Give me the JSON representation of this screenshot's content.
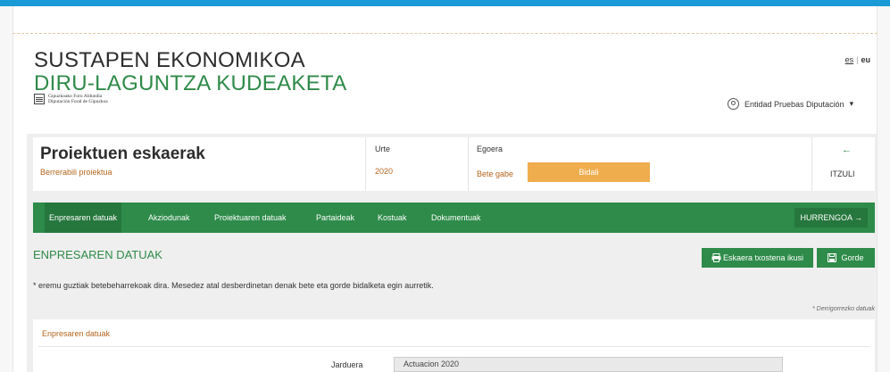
{
  "header": {
    "title_line1": "SUSTAPEN EKONOMIKOA",
    "title_line2": "DIRU-LAGUNTZA KUDEAKETA",
    "logo_line1": "Gipuzkoako Foru Aldundia",
    "logo_line2": "Diputación Foral de Gipuzkoa",
    "lang_es": "es",
    "lang_sep": "|",
    "lang_eu": "eu",
    "user_name": "Entidad Pruebas Diputación",
    "user_caret": "▾"
  },
  "project": {
    "title": "Proiektuen eskaerak",
    "subtitle": "Berrerabili proiektua",
    "year_label": "Urte",
    "year_value": "2020",
    "status_label": "Egoera",
    "status_value": "Bete gabe",
    "send_label": "Bidali",
    "back_arrow": "←",
    "back_label": "ITZULI"
  },
  "tabs": [
    {
      "label": "Enpresaren datuak"
    },
    {
      "label": "Akziodunak"
    },
    {
      "label": "Proiektuaren datuak"
    },
    {
      "label": "Partaideak"
    },
    {
      "label": "Kostuak"
    },
    {
      "label": "Dokumentuak"
    }
  ],
  "next_label": "HURRENGOA →",
  "section": {
    "title": "ENPRESAREN DATUAK",
    "print_label": "Eskaera txostena ikusi",
    "save_label": "Gorde",
    "notice": "* eremu guztiak betebeharrekoak dira. Mesedez atal desberdinetan denak bete eta gorde bidalketa egin aurretik.",
    "required_note": "* Derrigorrezko datuak"
  },
  "form": {
    "legend": "Enpresaren datuak",
    "activity_label": "Jarduera",
    "activity_value": "Actuacion 2020"
  },
  "colors": {
    "topbar": "#1a9ad6",
    "green": "#2e8b4a",
    "orange_button": "#f0ad4e",
    "accent_text": "#b5651d"
  }
}
